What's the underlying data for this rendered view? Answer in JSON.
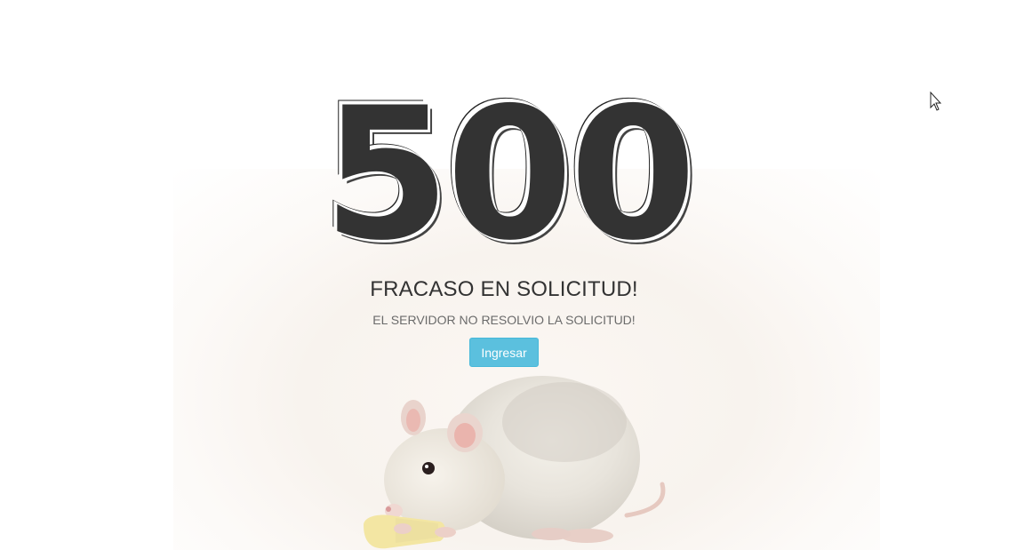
{
  "error": {
    "code": "500",
    "title": "FRACASO EN SOLICITUD!",
    "message": "EL SERVIDOR NO RESOLVIO LA SOLICITUD!"
  },
  "actions": {
    "login_label": "Ingresar"
  },
  "colors": {
    "code_text": "#333333",
    "button_bg": "#5bc0de",
    "button_border": "#46b8da",
    "button_text": "#ffffff"
  },
  "icons": {
    "illustration": "rat-illustration",
    "pointer": "mouse-cursor-icon"
  }
}
